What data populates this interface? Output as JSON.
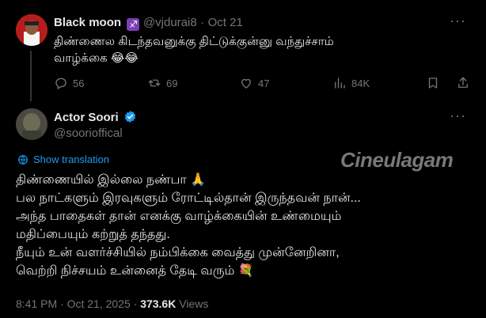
{
  "reply": {
    "name": "Black moon",
    "handle": "@vjdurai8",
    "separator": "·",
    "date": "Oct 21",
    "text_lines": [
      "திண்ணைல கிடந்தவனுக்கு திட்டுக்குன்னு வந்துச்சாம்",
      "வாழ்க்கை 😂😂"
    ],
    "stats": {
      "replies": "56",
      "reposts": "69",
      "likes": "47",
      "views": "84K"
    }
  },
  "main": {
    "name": "Actor Soori",
    "handle": "@soorioffical",
    "show_translation": "Show translation",
    "text_lines": [
      "திண்ணையில் இல்லை நண்பா 🙏",
      "பல நாட்களும் இரவுகளும் ரோட்டில்தான் இருந்தவன் நான்...",
      "அந்த பாதைகள் தான் எனக்கு வாழ்க்கையின் உண்மையும்",
      "மதிப்பையும் கற்றுத் தந்தது.",
      "நீயும் உன் வளர்ச்சியில் நம்பிக்கை வைத்து முன்னேறினா,",
      "வெற்றி நிச்சயம் உன்னைத் தேடி வரும் 💐"
    ],
    "time": "8:41 PM · Oct 21, 2025 ·",
    "views_count": "373.6K",
    "views_label": "Views"
  },
  "watermark": "Cineulagam",
  "colors": {
    "accent": "#1d9bf0",
    "verified": "#1d9bf0",
    "sagittarius": "#7b3fb5"
  }
}
